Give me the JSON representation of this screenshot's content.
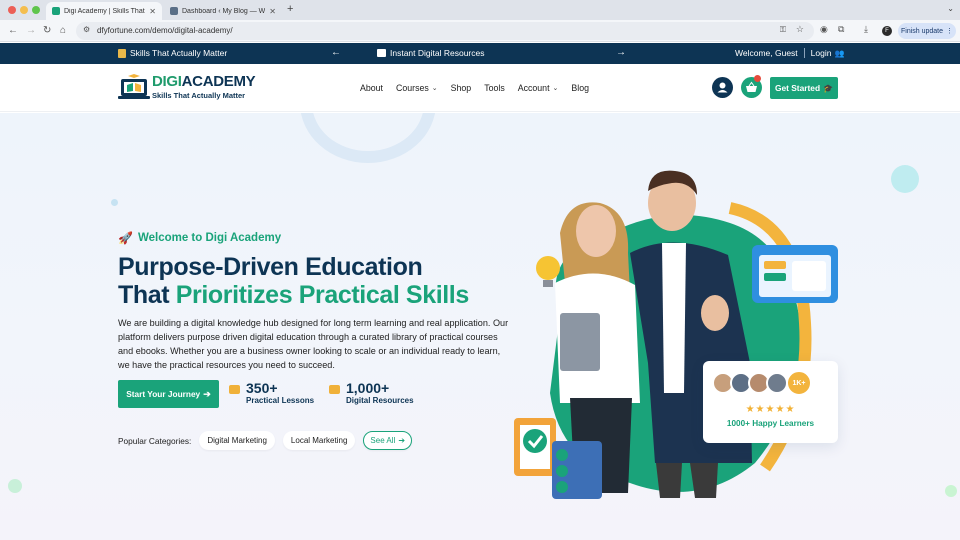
{
  "browser": {
    "tabs": [
      {
        "title": "Digi Academy | Skills That Actually Matter",
        "active": true
      },
      {
        "title": "Dashboard ‹ My Blog — WordPress",
        "active": false
      }
    ],
    "url": "dfyfortune.com/demo/digital-academy/",
    "finish_update": "Finish update",
    "profile_initial": "F"
  },
  "topbar": {
    "left_text": "Skills That Actually Matter",
    "mid_text": "Instant Digital Resources",
    "welcome": "Welcome, Guest",
    "login": "Login"
  },
  "header": {
    "logo_digi": "DIGI",
    "logo_academy": "ACADEMY",
    "logo_tagline": "Skills That Actually Matter",
    "nav": [
      {
        "label": "About",
        "has_dropdown": false
      },
      {
        "label": "Courses",
        "has_dropdown": true
      },
      {
        "label": "Shop",
        "has_dropdown": false
      },
      {
        "label": "Tools",
        "has_dropdown": false
      },
      {
        "label": "Account",
        "has_dropdown": true
      },
      {
        "label": "Blog",
        "has_dropdown": false
      }
    ],
    "cta": "Get Started"
  },
  "hero": {
    "eyebrow": "Welcome to Digi Academy",
    "title_line1": "Purpose-Driven Education",
    "title_line2_plain": "That ",
    "title_line2_accent": "Prioritizes Practical Skills",
    "lead": "We are building a digital knowledge hub designed for long term learning and real application. Our platform delivers purpose driven digital education through a curated library of practical courses and ebooks. Whether you are a business owner looking to scale or an individual ready to learn, we have the practical resources you need to succeed.",
    "button": "Start Your Journey",
    "stats": [
      {
        "value": "350+",
        "label": "Practical Lessons"
      },
      {
        "value": "1,000+",
        "label": "Digital Resources"
      }
    ],
    "categories_label": "Popular Categories:",
    "categories": [
      "Digital Marketing",
      "Local Marketing"
    ],
    "see_all": "See All",
    "learners_badge": "1K+",
    "learners_text": "1000+ Happy Learners",
    "rating_stars": 5
  },
  "colors": {
    "navy": "#0d3454",
    "green": "#1aa37a",
    "gold": "#f3b43d"
  }
}
